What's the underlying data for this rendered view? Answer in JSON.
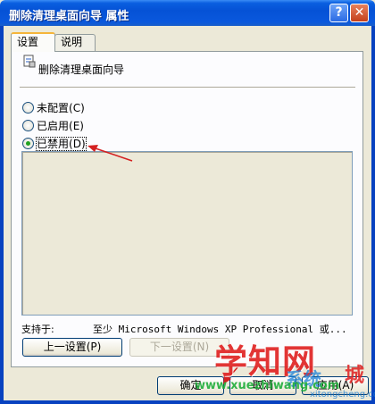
{
  "window": {
    "title": "删除清理桌面向导 属性",
    "help_glyph": "?",
    "close_glyph": "✕"
  },
  "tabs": [
    {
      "label": "设置",
      "active": true
    },
    {
      "label": "说明",
      "active": false
    }
  ],
  "policy": {
    "icon": "policy-setting-icon",
    "name": "删除清理桌面向导"
  },
  "options": [
    {
      "label": "未配置",
      "accel": "(C)",
      "checked": false
    },
    {
      "label": "已启用",
      "accel": "(E)",
      "checked": false
    },
    {
      "label": "已禁用",
      "accel": "(D)",
      "checked": true
    }
  ],
  "supported": {
    "label": "支持于:",
    "value": "至少 Microsoft Windows XP Professional 或..."
  },
  "nav": {
    "prev_label": "上一设置(P)",
    "next_label": "下一设置(N)"
  },
  "footer": {
    "ok_label": "确定",
    "cancel_label": "取消",
    "apply_label": "应用(A)"
  },
  "watermark": {
    "main": "学知网",
    "url": "www.xuezhiwang.com",
    "site": "系统",
    "city": "城",
    "site_small": "xitongcheng.com"
  },
  "colors": {
    "titlebar": "#0552d6",
    "dialog_bg": "#ece9d8",
    "annotation": "#d42020"
  }
}
